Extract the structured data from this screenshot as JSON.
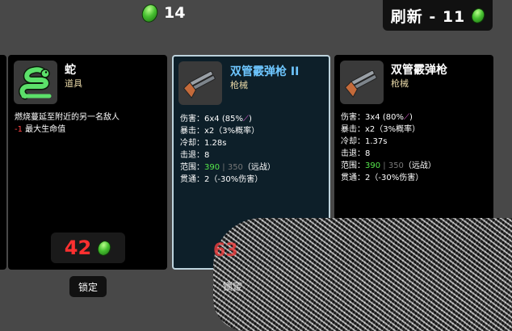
{
  "hud": {
    "currency": "14",
    "reroll_label": "刷新 - 11"
  },
  "cards": {
    "snake": {
      "name": "蛇",
      "type": "道具",
      "desc_line1": "燃烧蔓延至附近的另一名敌人",
      "desc_line2_value": "-1",
      "desc_line2_text": " 最大生命值",
      "price": "42",
      "lock_label": "锁定"
    },
    "gun2": {
      "name": "双管霰弹枪 II",
      "type": "枪械",
      "stats": {
        "damage_label": "伤害：",
        "damage_value": "6x4 (85%",
        "crit_label": "暴击：",
        "crit_value": "x2（3%概率）",
        "cooldown_label": "冷却：",
        "cooldown_value": "1.28s",
        "knockback_label": "击退：",
        "knockback_value": "8",
        "range_label": "范围：",
        "range_value_a": "390",
        "range_value_b": "350",
        "range_value_c": "（远战）",
        "pierce_label": "贯通：",
        "pierce_value": "2（-30%伤害）"
      },
      "price": "63",
      "lock_label": "锁定"
    },
    "gun1": {
      "name": "双管霰弹枪",
      "type": "枪械",
      "stats": {
        "damage_label": "伤害：",
        "damage_value": "3x4 (80%",
        "crit_label": "暴击：",
        "crit_value": "x2（3%概率）",
        "cooldown_label": "冷却：",
        "cooldown_value": "1.37s",
        "knockback_label": "击退：",
        "knockback_value": "8",
        "range_label": "范围：",
        "range_value_a": "390",
        "range_value_b": "350",
        "range_value_c": "（远战）",
        "pierce_label": "贯通：",
        "pierce_value": "2（-30%伤害）"
      }
    }
  },
  "colors": {
    "background": "#484848",
    "card": "#000000",
    "selected_card": "#0d1f29",
    "price_red": "#ff3030",
    "stat_green": "#56e84b"
  }
}
